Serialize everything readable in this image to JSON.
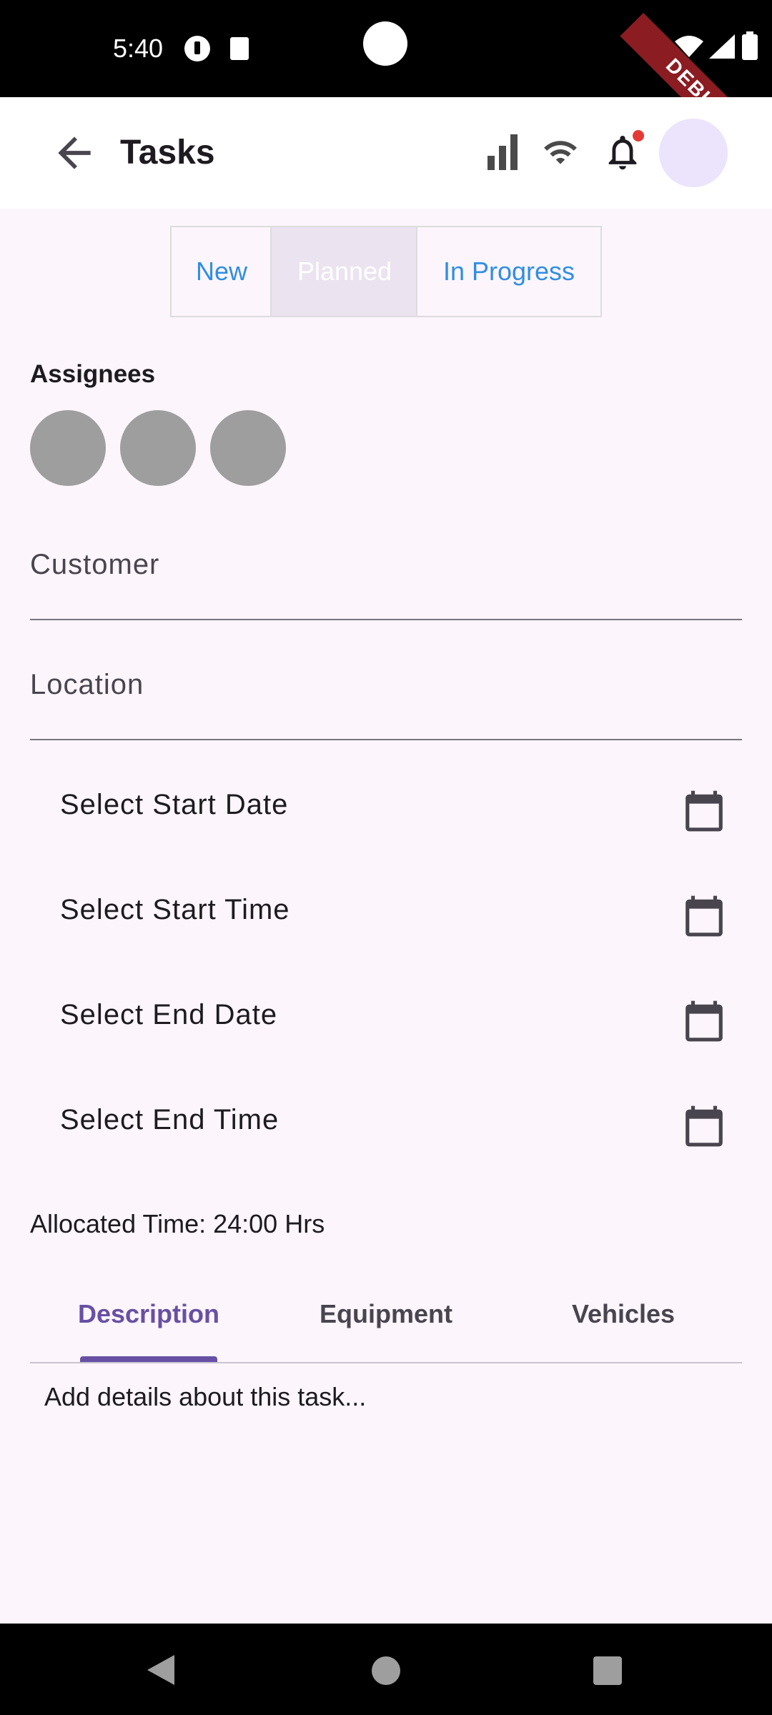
{
  "status_bar": {
    "time": "5:40"
  },
  "debug_banner": "DEBUG",
  "app_bar": {
    "title": "Tasks",
    "icons": [
      "arrow-back-icon",
      "signal-icon",
      "wifi-icon",
      "notification-bell-icon",
      "avatar"
    ]
  },
  "status_segments": {
    "items": [
      {
        "label": "New"
      },
      {
        "label": "Planned"
      },
      {
        "label": "In Progress"
      }
    ],
    "selected": "Planned"
  },
  "assignees": {
    "label": "Assignees",
    "count_shown": 3
  },
  "form": {
    "customer_label": "Customer",
    "location_label": "Location",
    "start_date": "Select Start Date",
    "start_time": "Select Start Time",
    "end_date": "Select End Date",
    "end_time": "Select End Time"
  },
  "allocated_time": "Allocated Time: 24:00 Hrs",
  "tabs": {
    "items": [
      {
        "label": "Description"
      },
      {
        "label": "Equipment"
      },
      {
        "label": "Vehicles"
      }
    ],
    "selected": "Description"
  },
  "description_placeholder": "Add details about this task...",
  "colors": {
    "accent": "#6750a4",
    "segment_text": "#2f8ee3",
    "background": "#fcf5fc",
    "avatar_placeholder": "#9e9e9e"
  }
}
